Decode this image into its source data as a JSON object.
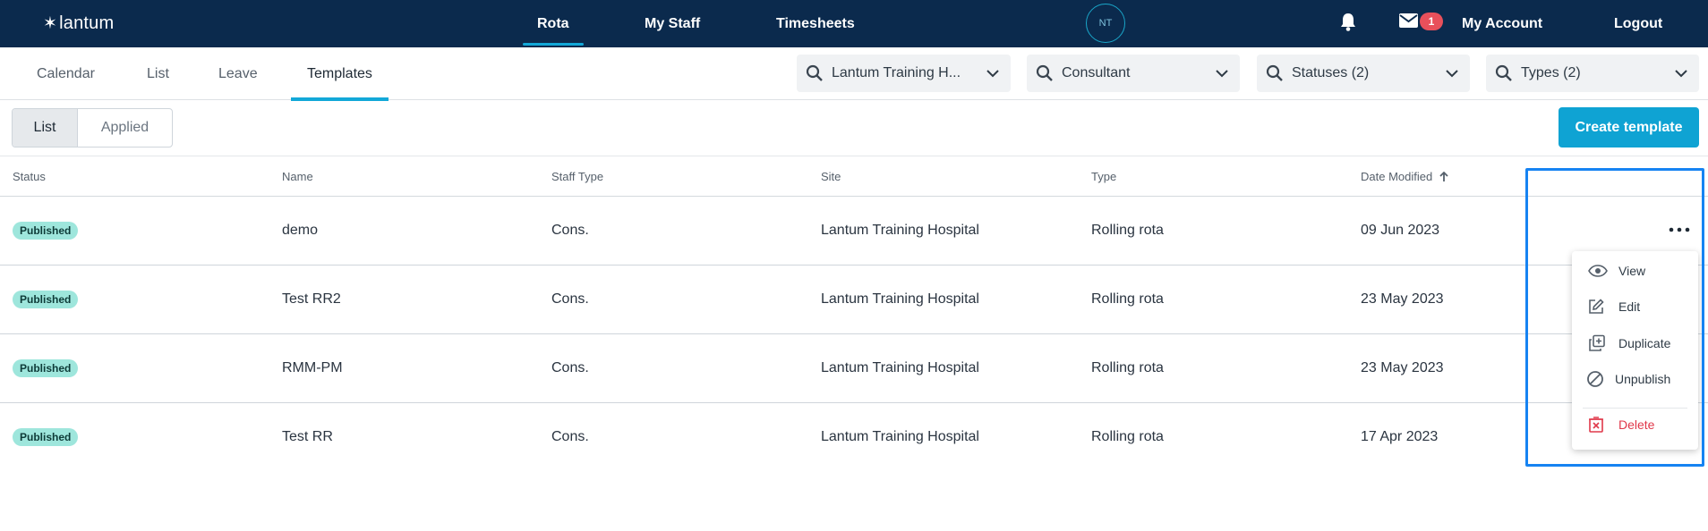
{
  "topnav": {
    "logo": "lantum",
    "items": [
      "Rota",
      "My Staff",
      "Timesheets"
    ],
    "avatar_initials": "NT",
    "mail_count": "1",
    "account": "My Account",
    "logout": "Logout"
  },
  "subnav": {
    "tabs": [
      "Calendar",
      "List",
      "Leave",
      "Templates"
    ],
    "active_tab": "Templates"
  },
  "filters": [
    {
      "label": "Lantum Training H..."
    },
    {
      "label": "Consultant"
    },
    {
      "label": "Statuses (2)"
    },
    {
      "label": "Types (2)"
    }
  ],
  "toolbar": {
    "view_options": [
      "List",
      "Applied"
    ],
    "selected_view": "List",
    "create_button": "Create template"
  },
  "table": {
    "headers": [
      "Status",
      "Name",
      "Staff Type",
      "Site",
      "Type",
      "Date Modified"
    ],
    "sort_column": "Date Modified",
    "sort_direction": "ascending",
    "rows": [
      {
        "status": "Published",
        "name": "demo",
        "staff_type": "Cons.",
        "site": "Lantum Training Hospital",
        "type": "Rolling rota",
        "date": "09 Jun 2023"
      },
      {
        "status": "Published",
        "name": "Test RR2",
        "staff_type": "Cons.",
        "site": "Lantum Training Hospital",
        "type": "Rolling rota",
        "date": "23 May 2023"
      },
      {
        "status": "Published",
        "name": "RMM-PM",
        "staff_type": "Cons.",
        "site": "Lantum Training Hospital",
        "type": "Rolling rota",
        "date": "23 May 2023"
      },
      {
        "status": "Published",
        "name": "Test RR",
        "staff_type": "Cons.",
        "site": "Lantum Training Hospital",
        "type": "Rolling rota",
        "date": "17 Apr 2023"
      }
    ]
  },
  "row_menu": {
    "items": [
      {
        "label": "View",
        "icon": "eye-icon"
      },
      {
        "label": "Edit",
        "icon": "edit-icon"
      },
      {
        "label": "Duplicate",
        "icon": "duplicate-icon"
      },
      {
        "label": "Unpublish",
        "icon": "unpublish-icon"
      },
      {
        "label": "Delete",
        "icon": "delete-icon"
      }
    ]
  },
  "colors": {
    "topbar": "#0b2a4d",
    "accent": "#0fa3d3",
    "published_badge": "#9ee6dc",
    "highlight": "#1683f2",
    "danger": "#e0384a"
  }
}
